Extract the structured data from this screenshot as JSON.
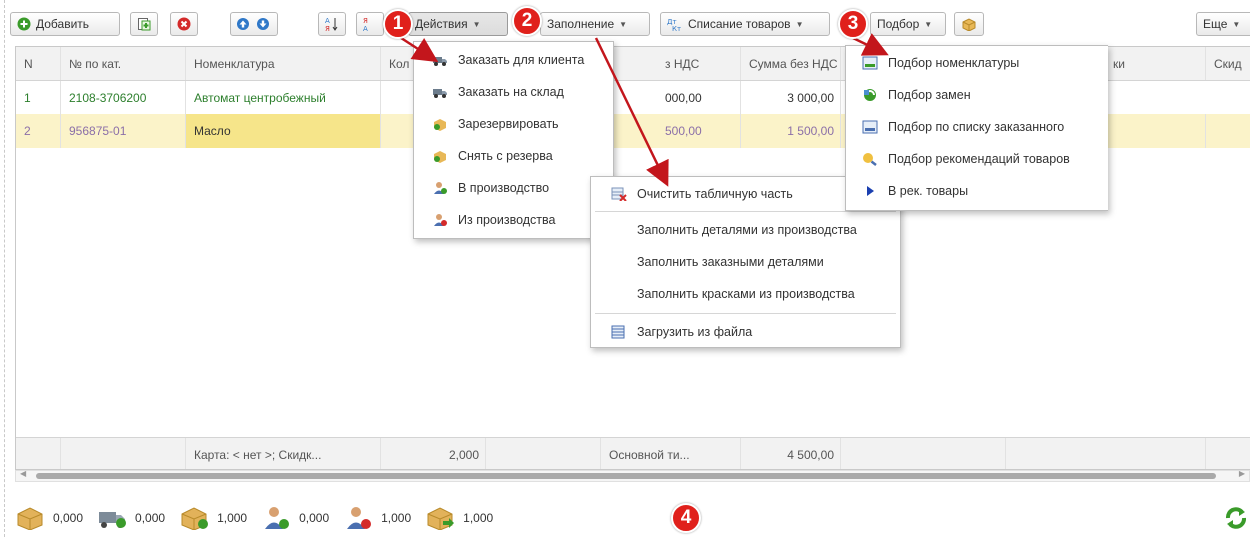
{
  "toolbar": {
    "add_label": "Добавить",
    "actions_label": "Действия",
    "fill_label": "Заполнение",
    "writeoff_label": "Списание товаров",
    "pick_label": "Подбор",
    "more_label": "Еще"
  },
  "table": {
    "headers": [
      "N",
      "№ по кат.",
      "Номенклатура",
      "Кол",
      "з НДС",
      "Сумма без НДС",
      "ки",
      "Скид"
    ],
    "rows": [
      {
        "n": "1",
        "cat": "2108-3706200",
        "name": "Автомат центробежный",
        "price": "000,00",
        "sum": "3 000,00"
      },
      {
        "n": "2",
        "cat": "956875-01",
        "name": "Масло",
        "price": "500,00",
        "sum": "1 500,00"
      }
    ],
    "footer": {
      "card": "Карта: < нет >; Скидк...",
      "qty": "2,000",
      "price_type": "Основной ти...",
      "total": "4 500,00"
    }
  },
  "menus": {
    "actions": [
      {
        "label": "Заказать для клиента",
        "icon": "truck-icon"
      },
      {
        "label": "Заказать на склад",
        "icon": "truck-icon"
      },
      {
        "label": "Зарезервировать",
        "icon": "reserve-icon"
      },
      {
        "label": "Снять с резерва",
        "icon": "unreserve-icon"
      },
      {
        "label": "В производство",
        "icon": "worker-icon"
      },
      {
        "label": "Из производства",
        "icon": "worker-icon"
      }
    ],
    "fill": [
      {
        "label": "Очистить табличную часть",
        "icon": "clear-table-icon"
      },
      {
        "label": "Заполнить деталями из производства"
      },
      {
        "label": "Заполнить заказными деталями"
      },
      {
        "label": "Заполнить красками из производства"
      },
      {
        "label": "Загрузить из файла",
        "icon": "load-file-icon"
      }
    ],
    "pick": [
      {
        "label": "Подбор номенклатуры",
        "icon": "catalog-icon"
      },
      {
        "label": "Подбор замен",
        "icon": "replace-icon"
      },
      {
        "label": "Подбор по списку заказанного",
        "icon": "list-icon"
      },
      {
        "label": "Подбор рекомендаций товаров",
        "icon": "search-icon"
      },
      {
        "label": "В рек. товары",
        "icon": "arrow-right-icon"
      }
    ]
  },
  "badges": [
    "1",
    "2",
    "3",
    "4"
  ],
  "status": [
    "0,000",
    "0,000",
    "1,000",
    "0,000",
    "1,000",
    "1,000"
  ],
  "colors": {
    "accent_red": "#e0201b",
    "selected_row": "#f6e58a",
    "green_text": "#2d7f2d"
  }
}
